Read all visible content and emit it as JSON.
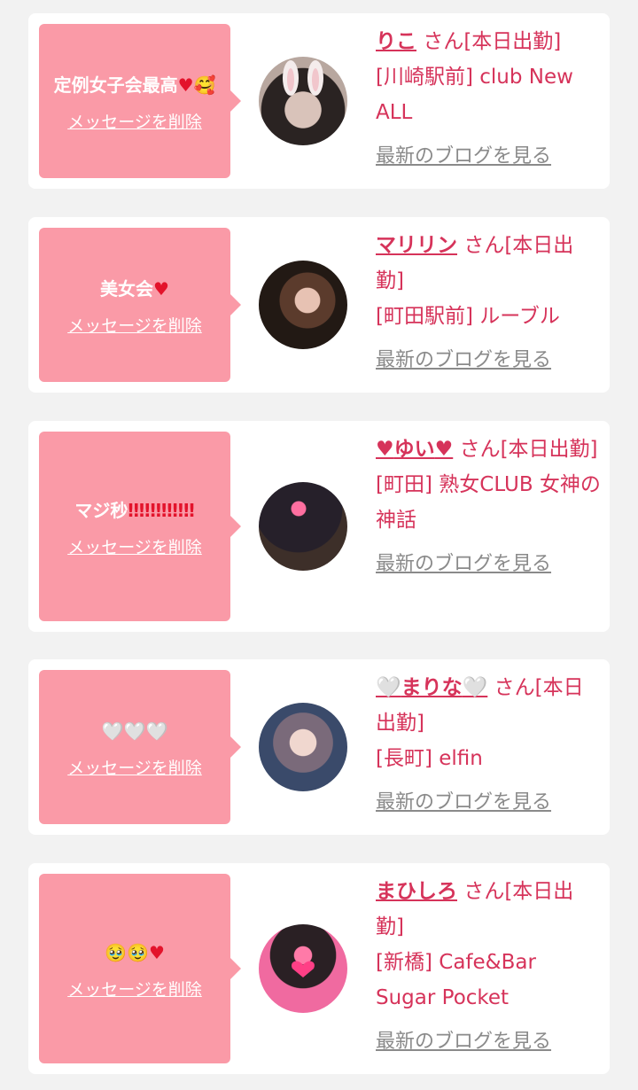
{
  "colors": {
    "accent": "#d6335a",
    "bubble": "#fa9aa7",
    "muted": "#8a8a8a"
  },
  "cards": [
    {
      "message": "定例女子会最高♥🥰",
      "delete_label": "メッセージを削除",
      "name": "りこ",
      "name_suffix": "さん[本日出勤]",
      "store": "[川崎駅前] club New ALL",
      "blog_label": "最新のブログを見る"
    },
    {
      "message": "美女会♥",
      "delete_label": "メッセージを削除",
      "name": "マリリン",
      "name_suffix": "さん[本日出勤]",
      "store": "[町田駅前] ルーブル",
      "blog_label": "最新のブログを見る"
    },
    {
      "message": "マジ秒‼‼‼‼‼‼",
      "delete_label": "メッセージを削除",
      "name": "♥ゆい♥",
      "name_suffix": "さん[本日出勤]",
      "store": "[町田] 熟女CLUB 女神の神話",
      "blog_label": "最新のブログを見る"
    },
    {
      "message": "🤍🤍🤍",
      "delete_label": "メッセージを削除",
      "name": "🤍まりな🤍",
      "name_suffix": "さん[本日出勤]",
      "store": "[長町] elfin",
      "blog_label": "最新のブログを見る"
    },
    {
      "message": "🥹🥹♥",
      "delete_label": "メッセージを削除",
      "name": "まひしろ",
      "name_suffix": "さん[本日出勤]",
      "store": "[新橋] Cafe&Bar Sugar Pocket",
      "blog_label": "最新のブログを見る"
    }
  ]
}
